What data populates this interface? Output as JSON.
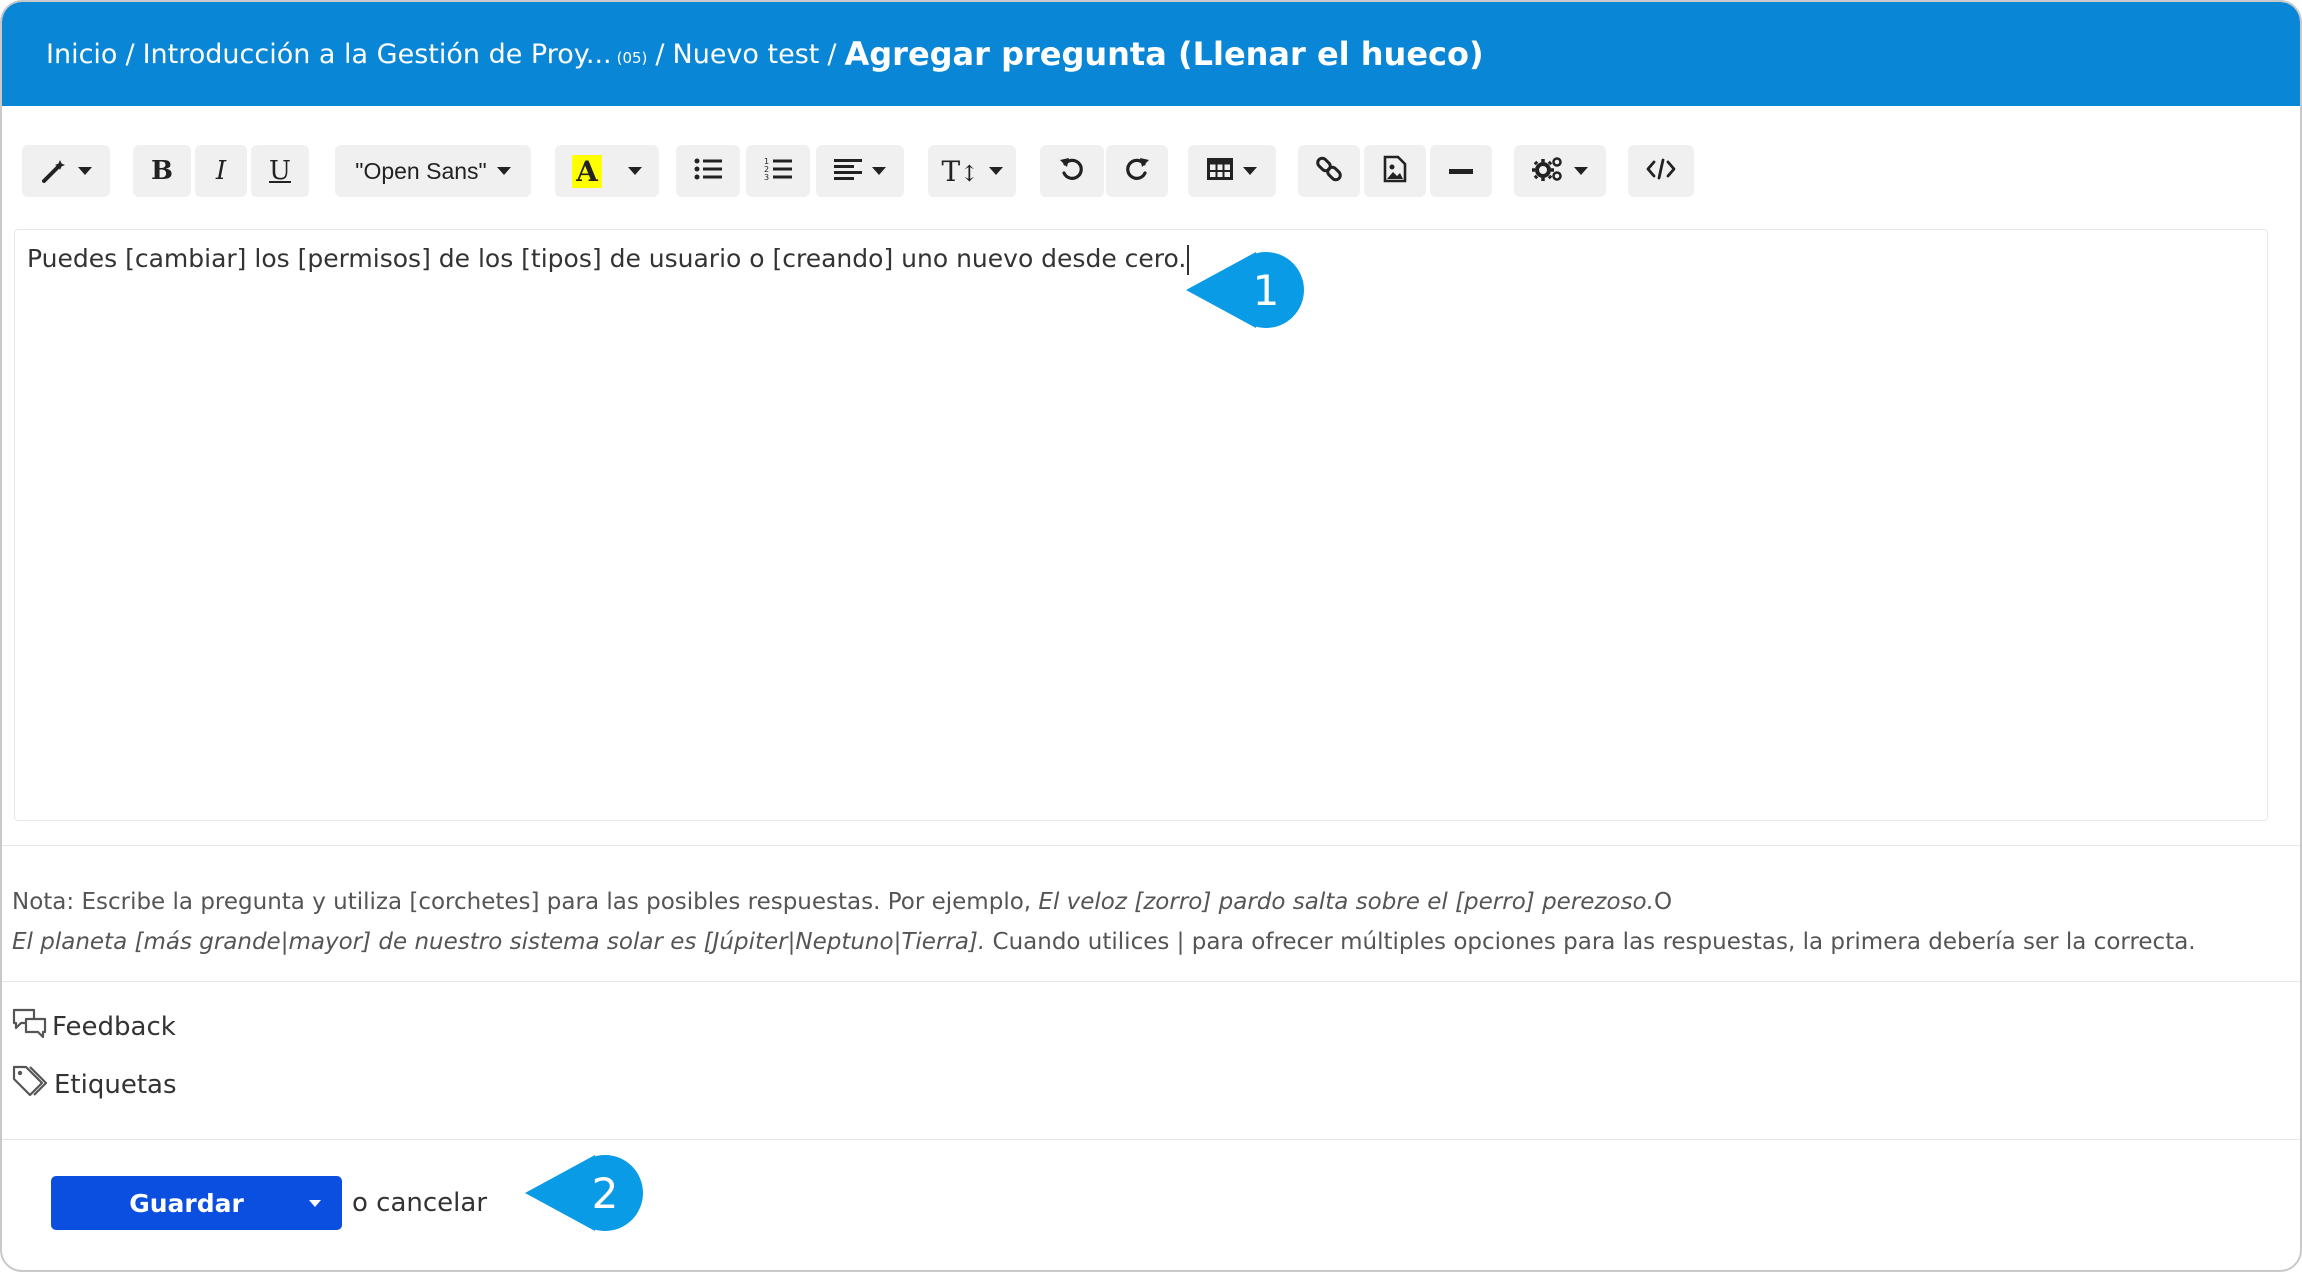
{
  "breadcrumb": {
    "home": "Inicio",
    "course": "Introducción a la Gestión de Proy...",
    "course_count": "(05)",
    "test": "Nuevo test",
    "separator": "/",
    "current": "Agregar pregunta (Llenar el hueco)"
  },
  "toolbar": {
    "font_name": "\"Open Sans\"",
    "bold": "B",
    "italic": "I",
    "underline": "U",
    "highlight": "A",
    "text_size": "T",
    "highlight_color": "#ffff00"
  },
  "editor": {
    "content": "Puedes [cambiar] los [permisos] de los [tipos] de usuario o [creando] uno nuevo desde cero."
  },
  "note": {
    "prefix": "Nota: Escribe la pregunta y utiliza [corchetes] para las posibles respuestas. Por ejemplo, ",
    "example1": "El veloz [zorro] pardo salta sobre el [perro] perezoso.",
    "or": "O",
    "example2": "El planeta [más grande|mayor] de nuestro sistema solar es [Júpiter|Neptuno|Tierra].",
    "suffix": " Cuando utilices | para ofrecer múltiples opciones para las respuestas, la primera debería ser la correcta."
  },
  "sections": {
    "feedback": "Feedback",
    "tags": "Etiquetas"
  },
  "actions": {
    "save": "Guardar",
    "cancel": "o cancelar"
  },
  "callouts": {
    "first": "1",
    "second": "2"
  },
  "colors": {
    "header": "#0a86d7",
    "save_button": "#0b4fe0",
    "callout": "#0a9be6"
  }
}
